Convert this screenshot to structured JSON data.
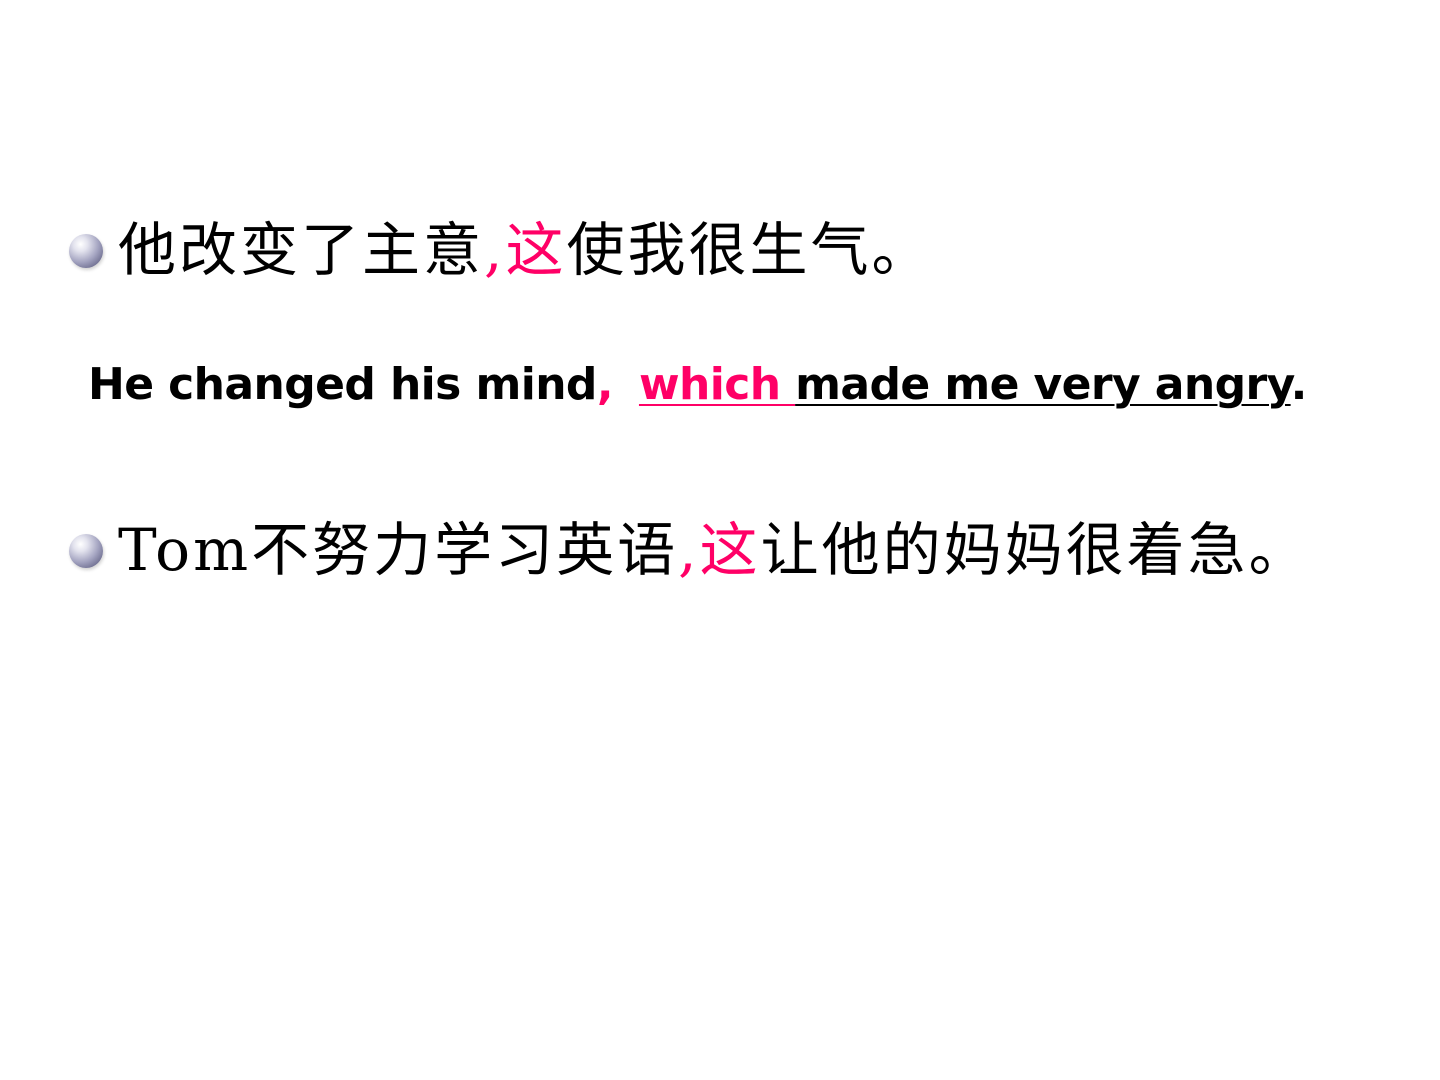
{
  "lines": [
    {
      "before": "他改变了主意",
      "comma": ",",
      "highlight": "这",
      "after": "使我很生气。"
    },
    {
      "before": "Tom不努力学习英语",
      "comma": ",",
      "highlight": "这",
      "after": "让他的妈妈很着急。"
    }
  ],
  "translation": {
    "main": "He changed his mind",
    "comma": ",",
    "relative": "which ",
    "clause": "made me very angry",
    "period": "."
  },
  "colors": {
    "highlight": "#ff0066",
    "text": "#000000",
    "background": "#ffffff"
  },
  "bullet_icon": "sphere-bullet-icon"
}
